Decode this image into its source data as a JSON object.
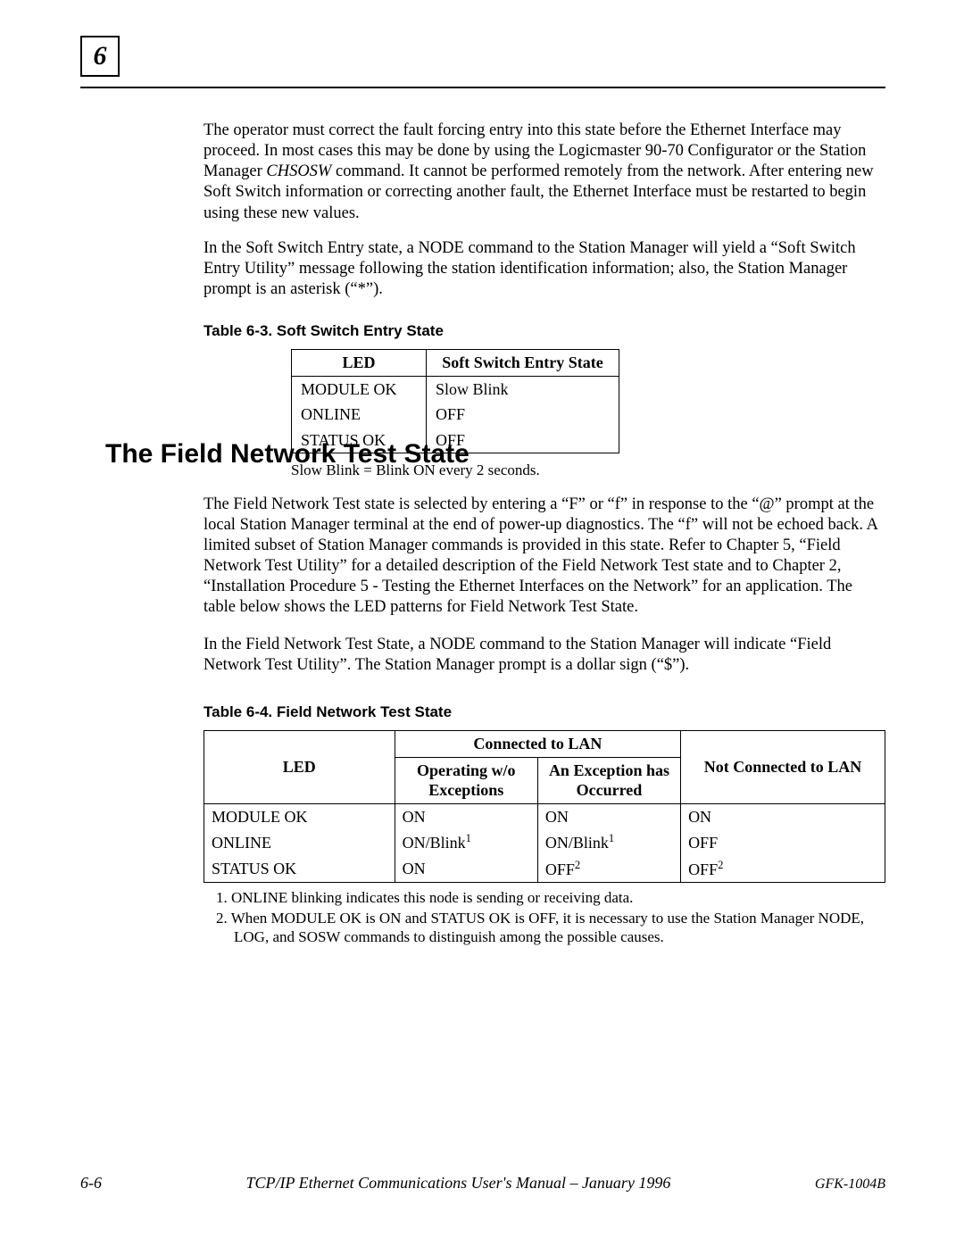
{
  "chapter_number": "6",
  "para1_a": "The operator must correct the fault forcing entry into this state before the Ethernet Interface may proceed.  In most cases this may be done by using the Logicmaster 90-70 Configurator or the Station Manager ",
  "para1_i": "CHSOSW",
  "para1_b": " command.  It cannot be performed remotely from the network.  After entering new Soft Switch information or correcting another fault, the Ethernet Interface must be restarted to begin using these new values.",
  "para2": "In the Soft Switch Entry state, a NODE command to the Station Manager will yield a “Soft Switch Entry Utility” message following the station identification information; also, the Station Manager prompt is an asterisk (“*”).",
  "t63_caption": "Table 6-3.  Soft Switch Entry State",
  "t63_h1": "LED",
  "t63_h2": "Soft Switch Entry State",
  "t63_r1c1": "MODULE OK",
  "t63_r1c2": "Slow Blink",
  "t63_r2c1": "ONLINE",
  "t63_r2c2": "OFF",
  "t63_r3c1": "STATUS OK",
  "t63_r3c2": "OFF",
  "t63_note": "Slow Blink = Blink ON every 2 seconds.",
  "section_heading": "The Field Network Test State",
  "para3": "The Field Network Test state is selected by entering a “F” or “f” in response to the “@” prompt at the local Station Manager terminal at the end of power-up diagnostics.  The “f” will not be echoed back.  A limited subset of Station Manager commands is provided in this state.  Refer to Chapter 5, “Field Network Test Utility” for a detailed description of the Field Network Test state and to Chapter 2, “Installation Procedure 5 - Testing the Ethernet Interfaces on the Network” for an application.  The table below shows the LED patterns for Field Network Test State.",
  "para4": "In the Field Network Test State, a NODE command to the Station Manager will indicate “Field Network Test Utility”.  The Station Manager prompt is a dollar sign (“$”).",
  "t64_caption": "Table 6-4.  Field Network Test State",
  "t64": {
    "h_led": "LED",
    "h_conn": "Connected to LAN",
    "h_a": "Operating w/o Exceptions",
    "h_b": "An Exception has Occurred",
    "h_nc": "Not Connected to LAN",
    "rows": [
      {
        "c1": "MODULE OK",
        "c2": "ON",
        "c3": "ON",
        "c4": "ON"
      },
      {
        "c1": "ONLINE",
        "c2": "ON/Blink",
        "c2sup": "1",
        "c3": "ON/Blink",
        "c3sup": "1",
        "c4": "OFF"
      },
      {
        "c1": "STATUS OK",
        "c2": "ON",
        "c3": "OFF",
        "c3sup": "2",
        "c4": "OFF",
        "c4sup": "2"
      }
    ]
  },
  "fn1": "1.   ONLINE blinking indicates this node is sending or receiving data.",
  "fn2": "2.   When MODULE OK is ON and STATUS OK is OFF, it is necessary to use the Station Manager NODE, LOG, and SOSW commands to distinguish among the possible causes.",
  "footer_page": "6-6",
  "footer_title": "TCP/IP Ethernet Communications User's Manual – January 1996",
  "footer_doc": "GFK-1004B"
}
